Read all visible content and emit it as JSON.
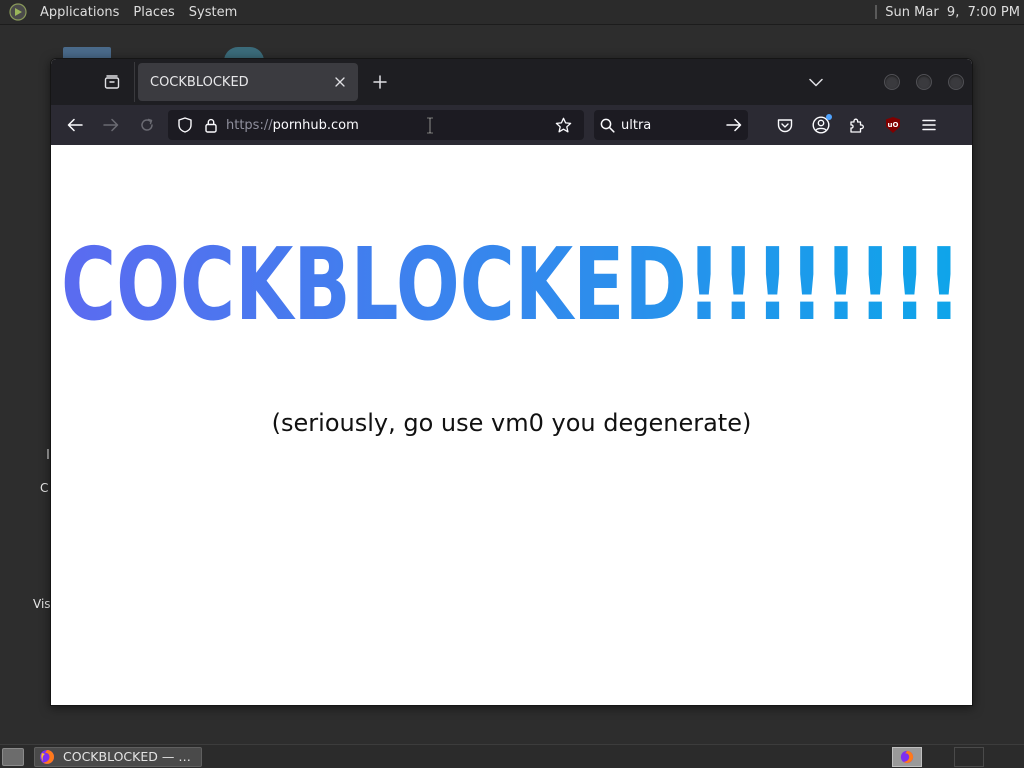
{
  "top_panel": {
    "menus": [
      "Applications",
      "Places",
      "System"
    ],
    "clock": "Sun Mar  9,  7:00 PM"
  },
  "desktop": {
    "labels": [
      "C",
      "Vis"
    ]
  },
  "browser": {
    "tab": {
      "title": "COCKBLOCKED"
    },
    "url": {
      "scheme": "https://",
      "host": "pornhub.com"
    },
    "search": {
      "value": "ultra"
    }
  },
  "page": {
    "headline": "COCKBLOCKED!!!!!!!!",
    "subline": "(seriously, go use vm0 you degenerate)",
    "gradient": {
      "from": "#5b6bf0",
      "to": "#0ea5ea"
    }
  },
  "taskbar": {
    "window_button": "COCKBLOCKED — …"
  },
  "colors": {
    "panel": "#2b2b2b",
    "desktop": "#2d2d2d",
    "tabbar": "#1e1e22",
    "navbar": "#2b2a33",
    "field": "#1c1b22"
  }
}
